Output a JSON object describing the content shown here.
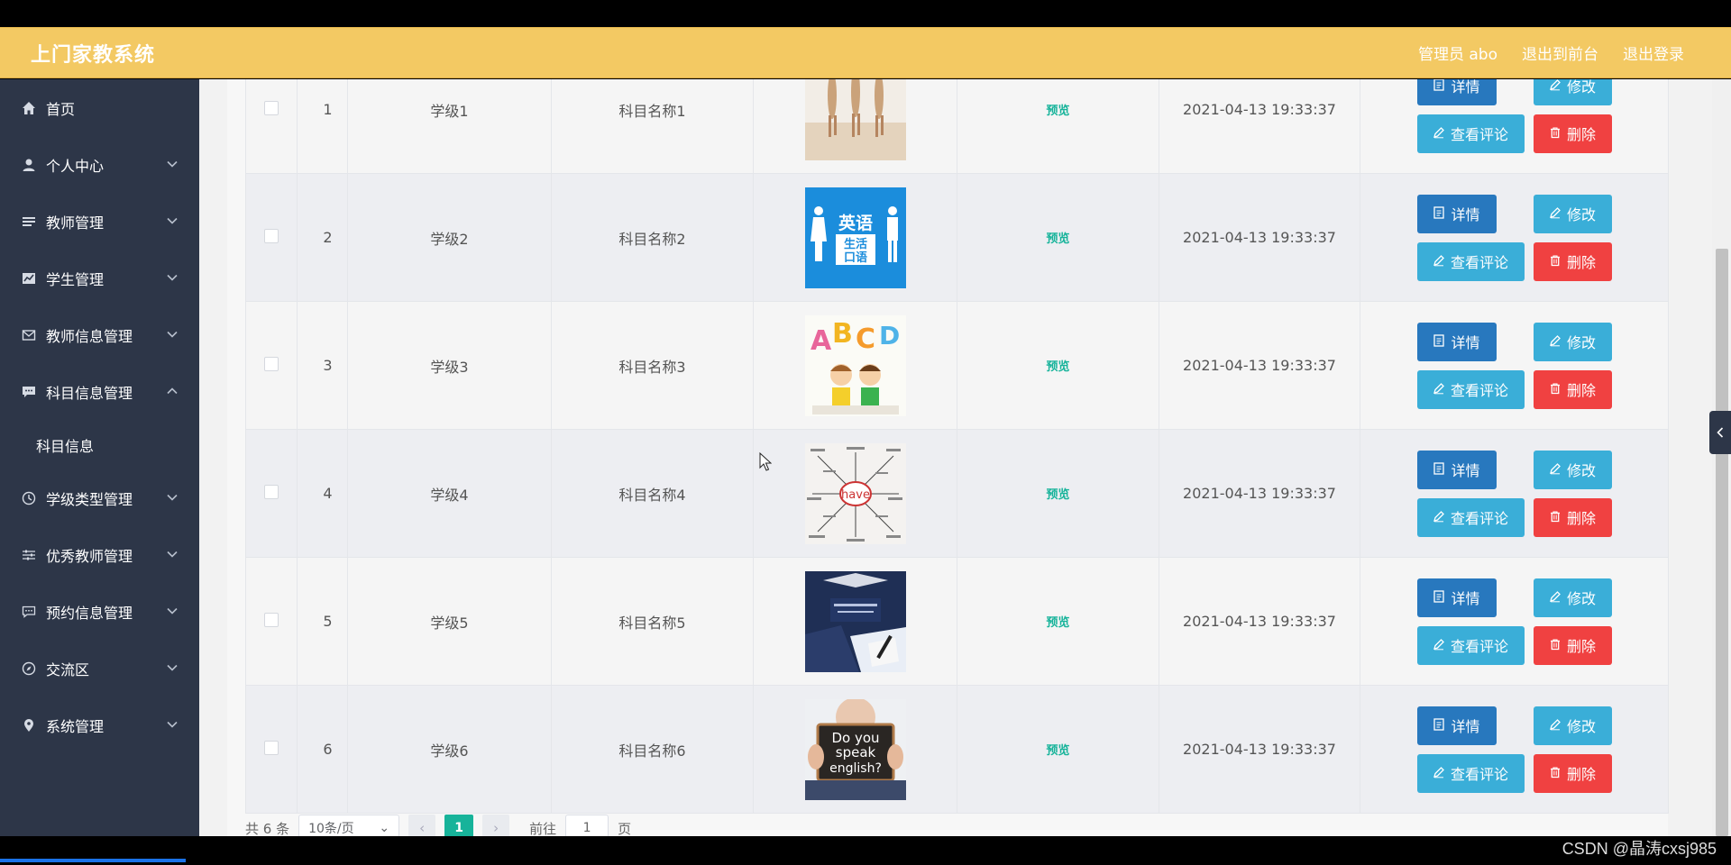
{
  "header": {
    "title": "上门家教系统",
    "admin_label": "管理员 abo",
    "front_label": "退出到前台",
    "logout_label": "退出登录"
  },
  "sidebar": {
    "items": [
      {
        "label": "首页",
        "icon": "home-icon"
      },
      {
        "label": "个人中心",
        "icon": "user-icon"
      },
      {
        "label": "教师管理",
        "icon": "list-icon"
      },
      {
        "label": "学生管理",
        "icon": "chart-icon"
      },
      {
        "label": "教师信息管理",
        "icon": "mail-icon"
      },
      {
        "label": "科目信息管理",
        "icon": "chat-icon"
      },
      {
        "label": "学级类型管理",
        "icon": "clock-icon"
      },
      {
        "label": "优秀教师管理",
        "icon": "sliders-icon"
      },
      {
        "label": "预约信息管理",
        "icon": "message-icon"
      },
      {
        "label": "交流区",
        "icon": "compass-icon"
      },
      {
        "label": "系统管理",
        "icon": "pin-icon"
      }
    ],
    "subitem": "科目信息"
  },
  "table": {
    "preview_label": "预览",
    "buttons": {
      "detail": "详情",
      "edit": "修改",
      "comment": "查看评论",
      "delete": "删除"
    },
    "rows": [
      {
        "num": "1",
        "level": "学级1",
        "subject": "科目名称1",
        "time": "2021-04-13 19:33:37",
        "image": "runners-image"
      },
      {
        "num": "2",
        "level": "学级2",
        "subject": "科目名称2",
        "time": "2021-04-13 19:33:37",
        "image": "english-sign-image"
      },
      {
        "num": "3",
        "level": "学级3",
        "subject": "科目名称3",
        "time": "2021-04-13 19:33:37",
        "image": "abcd-kids-image"
      },
      {
        "num": "4",
        "level": "学级4",
        "subject": "科目名称4",
        "time": "2021-04-13 19:33:37",
        "image": "have-mindmap-image"
      },
      {
        "num": "5",
        "level": "学级5",
        "subject": "科目名称5",
        "time": "2021-04-13 19:33:37",
        "image": "student-writing-image"
      },
      {
        "num": "6",
        "level": "学级6",
        "subject": "科目名称6",
        "time": "2021-04-13 19:33:37",
        "image": "speak-english-image"
      }
    ]
  },
  "pagination": {
    "total": "共 6 条",
    "page_size": "10条/页",
    "current_page": "1",
    "goto_prefix": "前往",
    "goto_value": "1",
    "goto_suffix": "页"
  },
  "watermark": "CSDN @晶涛cxsj985",
  "colors": {
    "header": "#f3c963",
    "sidebar": "#2d3648",
    "primary": "#2878be",
    "info": "#3aaed8",
    "danger": "#f04141",
    "accent": "#17b39a"
  },
  "sign_text": {
    "line1": "英语",
    "line2": "生活",
    "line3": "口语",
    "word": "have",
    "speak1": "Do you",
    "speak2": "speak",
    "speak3": "english?"
  }
}
